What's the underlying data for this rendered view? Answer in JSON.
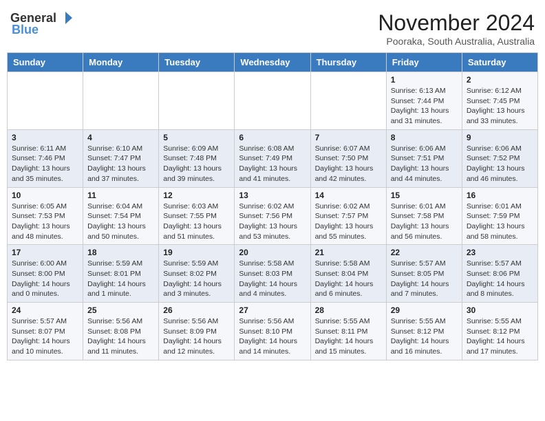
{
  "header": {
    "logo_general": "General",
    "logo_blue": "Blue",
    "month_title": "November 2024",
    "location": "Pooraka, South Australia, Australia"
  },
  "calendar": {
    "days_of_week": [
      "Sunday",
      "Monday",
      "Tuesday",
      "Wednesday",
      "Thursday",
      "Friday",
      "Saturday"
    ],
    "weeks": [
      [
        {
          "day": "",
          "info": ""
        },
        {
          "day": "",
          "info": ""
        },
        {
          "day": "",
          "info": ""
        },
        {
          "day": "",
          "info": ""
        },
        {
          "day": "",
          "info": ""
        },
        {
          "day": "1",
          "info": "Sunrise: 6:13 AM\nSunset: 7:44 PM\nDaylight: 13 hours and 31 minutes."
        },
        {
          "day": "2",
          "info": "Sunrise: 6:12 AM\nSunset: 7:45 PM\nDaylight: 13 hours and 33 minutes."
        }
      ],
      [
        {
          "day": "3",
          "info": "Sunrise: 6:11 AM\nSunset: 7:46 PM\nDaylight: 13 hours and 35 minutes."
        },
        {
          "day": "4",
          "info": "Sunrise: 6:10 AM\nSunset: 7:47 PM\nDaylight: 13 hours and 37 minutes."
        },
        {
          "day": "5",
          "info": "Sunrise: 6:09 AM\nSunset: 7:48 PM\nDaylight: 13 hours and 39 minutes."
        },
        {
          "day": "6",
          "info": "Sunrise: 6:08 AM\nSunset: 7:49 PM\nDaylight: 13 hours and 41 minutes."
        },
        {
          "day": "7",
          "info": "Sunrise: 6:07 AM\nSunset: 7:50 PM\nDaylight: 13 hours and 42 minutes."
        },
        {
          "day": "8",
          "info": "Sunrise: 6:06 AM\nSunset: 7:51 PM\nDaylight: 13 hours and 44 minutes."
        },
        {
          "day": "9",
          "info": "Sunrise: 6:06 AM\nSunset: 7:52 PM\nDaylight: 13 hours and 46 minutes."
        }
      ],
      [
        {
          "day": "10",
          "info": "Sunrise: 6:05 AM\nSunset: 7:53 PM\nDaylight: 13 hours and 48 minutes."
        },
        {
          "day": "11",
          "info": "Sunrise: 6:04 AM\nSunset: 7:54 PM\nDaylight: 13 hours and 50 minutes."
        },
        {
          "day": "12",
          "info": "Sunrise: 6:03 AM\nSunset: 7:55 PM\nDaylight: 13 hours and 51 minutes."
        },
        {
          "day": "13",
          "info": "Sunrise: 6:02 AM\nSunset: 7:56 PM\nDaylight: 13 hours and 53 minutes."
        },
        {
          "day": "14",
          "info": "Sunrise: 6:02 AM\nSunset: 7:57 PM\nDaylight: 13 hours and 55 minutes."
        },
        {
          "day": "15",
          "info": "Sunrise: 6:01 AM\nSunset: 7:58 PM\nDaylight: 13 hours and 56 minutes."
        },
        {
          "day": "16",
          "info": "Sunrise: 6:01 AM\nSunset: 7:59 PM\nDaylight: 13 hours and 58 minutes."
        }
      ],
      [
        {
          "day": "17",
          "info": "Sunrise: 6:00 AM\nSunset: 8:00 PM\nDaylight: 14 hours and 0 minutes."
        },
        {
          "day": "18",
          "info": "Sunrise: 5:59 AM\nSunset: 8:01 PM\nDaylight: 14 hours and 1 minute."
        },
        {
          "day": "19",
          "info": "Sunrise: 5:59 AM\nSunset: 8:02 PM\nDaylight: 14 hours and 3 minutes."
        },
        {
          "day": "20",
          "info": "Sunrise: 5:58 AM\nSunset: 8:03 PM\nDaylight: 14 hours and 4 minutes."
        },
        {
          "day": "21",
          "info": "Sunrise: 5:58 AM\nSunset: 8:04 PM\nDaylight: 14 hours and 6 minutes."
        },
        {
          "day": "22",
          "info": "Sunrise: 5:57 AM\nSunset: 8:05 PM\nDaylight: 14 hours and 7 minutes."
        },
        {
          "day": "23",
          "info": "Sunrise: 5:57 AM\nSunset: 8:06 PM\nDaylight: 14 hours and 8 minutes."
        }
      ],
      [
        {
          "day": "24",
          "info": "Sunrise: 5:57 AM\nSunset: 8:07 PM\nDaylight: 14 hours and 10 minutes."
        },
        {
          "day": "25",
          "info": "Sunrise: 5:56 AM\nSunset: 8:08 PM\nDaylight: 14 hours and 11 minutes."
        },
        {
          "day": "26",
          "info": "Sunrise: 5:56 AM\nSunset: 8:09 PM\nDaylight: 14 hours and 12 minutes."
        },
        {
          "day": "27",
          "info": "Sunrise: 5:56 AM\nSunset: 8:10 PM\nDaylight: 14 hours and 14 minutes."
        },
        {
          "day": "28",
          "info": "Sunrise: 5:55 AM\nSunset: 8:11 PM\nDaylight: 14 hours and 15 minutes."
        },
        {
          "day": "29",
          "info": "Sunrise: 5:55 AM\nSunset: 8:12 PM\nDaylight: 14 hours and 16 minutes."
        },
        {
          "day": "30",
          "info": "Sunrise: 5:55 AM\nSunset: 8:12 PM\nDaylight: 14 hours and 17 minutes."
        }
      ]
    ]
  }
}
